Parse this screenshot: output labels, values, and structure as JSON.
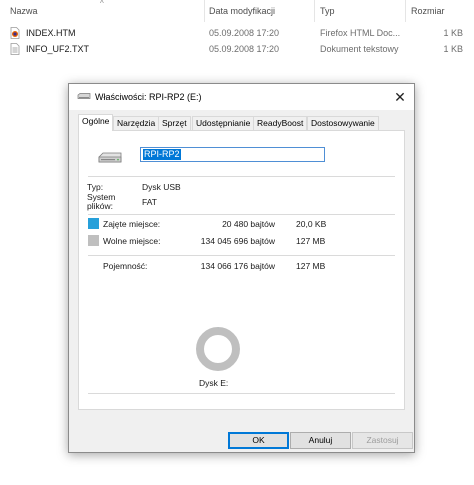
{
  "explorer": {
    "columns": {
      "name": "Nazwa",
      "modified": "Data modyfikacji",
      "type": "Typ",
      "size": "Rozmiar"
    },
    "sort_glyph": "^",
    "files": [
      {
        "name": "INDEX.HTM",
        "modified": "05.09.2008 17:20",
        "type": "Firefox HTML Doc...",
        "size": "1 KB",
        "icon": "firefox-html-file-icon"
      },
      {
        "name": "INFO_UF2.TXT",
        "modified": "05.09.2008 17:20",
        "type": "Dokument tekstowy",
        "size": "1 KB",
        "icon": "text-file-icon"
      }
    ]
  },
  "dialog": {
    "title": "Właściwości: RPI-RP2 (E:)",
    "close_glyph": "✕",
    "tabs": [
      "Ogólne",
      "Narzędzia",
      "Sprzęt",
      "Udostępnianie",
      "ReadyBoost",
      "Dostosowywanie"
    ],
    "active_tab": "Ogólne",
    "drive_name": "RPI-RP2",
    "type_label": "Typ:",
    "type_value": "Dysk USB",
    "fs_label_line1": "System",
    "fs_label_line2": "plików:",
    "fs_value": "FAT",
    "used": {
      "label": "Zajęte miejsce:",
      "bytes": "20 480 bajtów",
      "size": "20,0 KB",
      "color": "#26a0da"
    },
    "free": {
      "label": "Wolne miejsce:",
      "bytes": "134 045 696 bajtów",
      "size": "127 MB",
      "color": "#bfbfbf"
    },
    "capacity": {
      "label": "Pojemność:",
      "bytes": "134 066 176 bajtów",
      "size": "127 MB"
    },
    "used_fraction": 0.000153,
    "drive_label": "Dysk E:",
    "buttons": {
      "ok": "OK",
      "cancel": "Anuluj",
      "apply": "Zastosuj"
    }
  }
}
